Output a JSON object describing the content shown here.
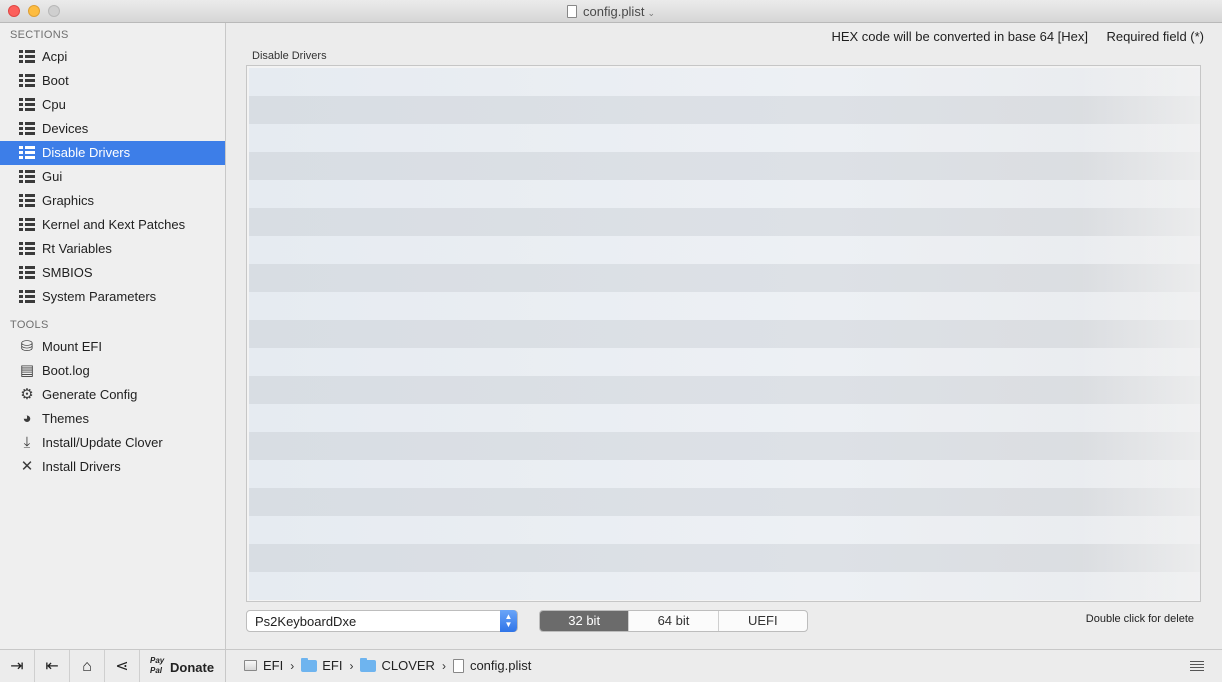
{
  "window": {
    "title": "config.plist"
  },
  "sidebar": {
    "sections_header": "SECTIONS",
    "sections": [
      {
        "label": "Acpi"
      },
      {
        "label": "Boot"
      },
      {
        "label": "Cpu"
      },
      {
        "label": "Devices"
      },
      {
        "label": "Disable Drivers",
        "selected": true
      },
      {
        "label": "Gui"
      },
      {
        "label": "Graphics"
      },
      {
        "label": "Kernel and Kext Patches"
      },
      {
        "label": "Rt Variables"
      },
      {
        "label": "SMBIOS"
      },
      {
        "label": "System Parameters"
      }
    ],
    "tools_header": "TOOLS",
    "tools": [
      {
        "label": "Mount EFI",
        "icon": "disk-icon"
      },
      {
        "label": "Boot.log",
        "icon": "log-icon"
      },
      {
        "label": "Generate Config",
        "icon": "gears-icon"
      },
      {
        "label": "Themes",
        "icon": "palette-icon"
      },
      {
        "label": "Install/Update Clover",
        "icon": "download-icon"
      },
      {
        "label": "Install Drivers",
        "icon": "tools-icon"
      }
    ],
    "bottom": {
      "paypal_line1": "Pay",
      "paypal_line2": "Pal",
      "donate_label": "Donate"
    }
  },
  "main": {
    "hex_note": "HEX code will be converted in base 64 [Hex]",
    "required_note": "Required field (*)",
    "group_label": "Disable Drivers",
    "driver_select": {
      "value": "Ps2KeyboardDxe"
    },
    "arch_segments": [
      {
        "label": "32 bit",
        "active": true
      },
      {
        "label": "64 bit",
        "active": false
      },
      {
        "label": "UEFI",
        "active": false
      }
    ],
    "delete_hint": "Double click for delete"
  },
  "pathbar": {
    "crumbs": [
      "EFI",
      "EFI",
      "CLOVER",
      "config.plist"
    ],
    "separator": "›"
  },
  "colors": {
    "selection": "#3d7ee8",
    "segment_active": "#6b6b6b",
    "folder": "#6eb4ef"
  }
}
